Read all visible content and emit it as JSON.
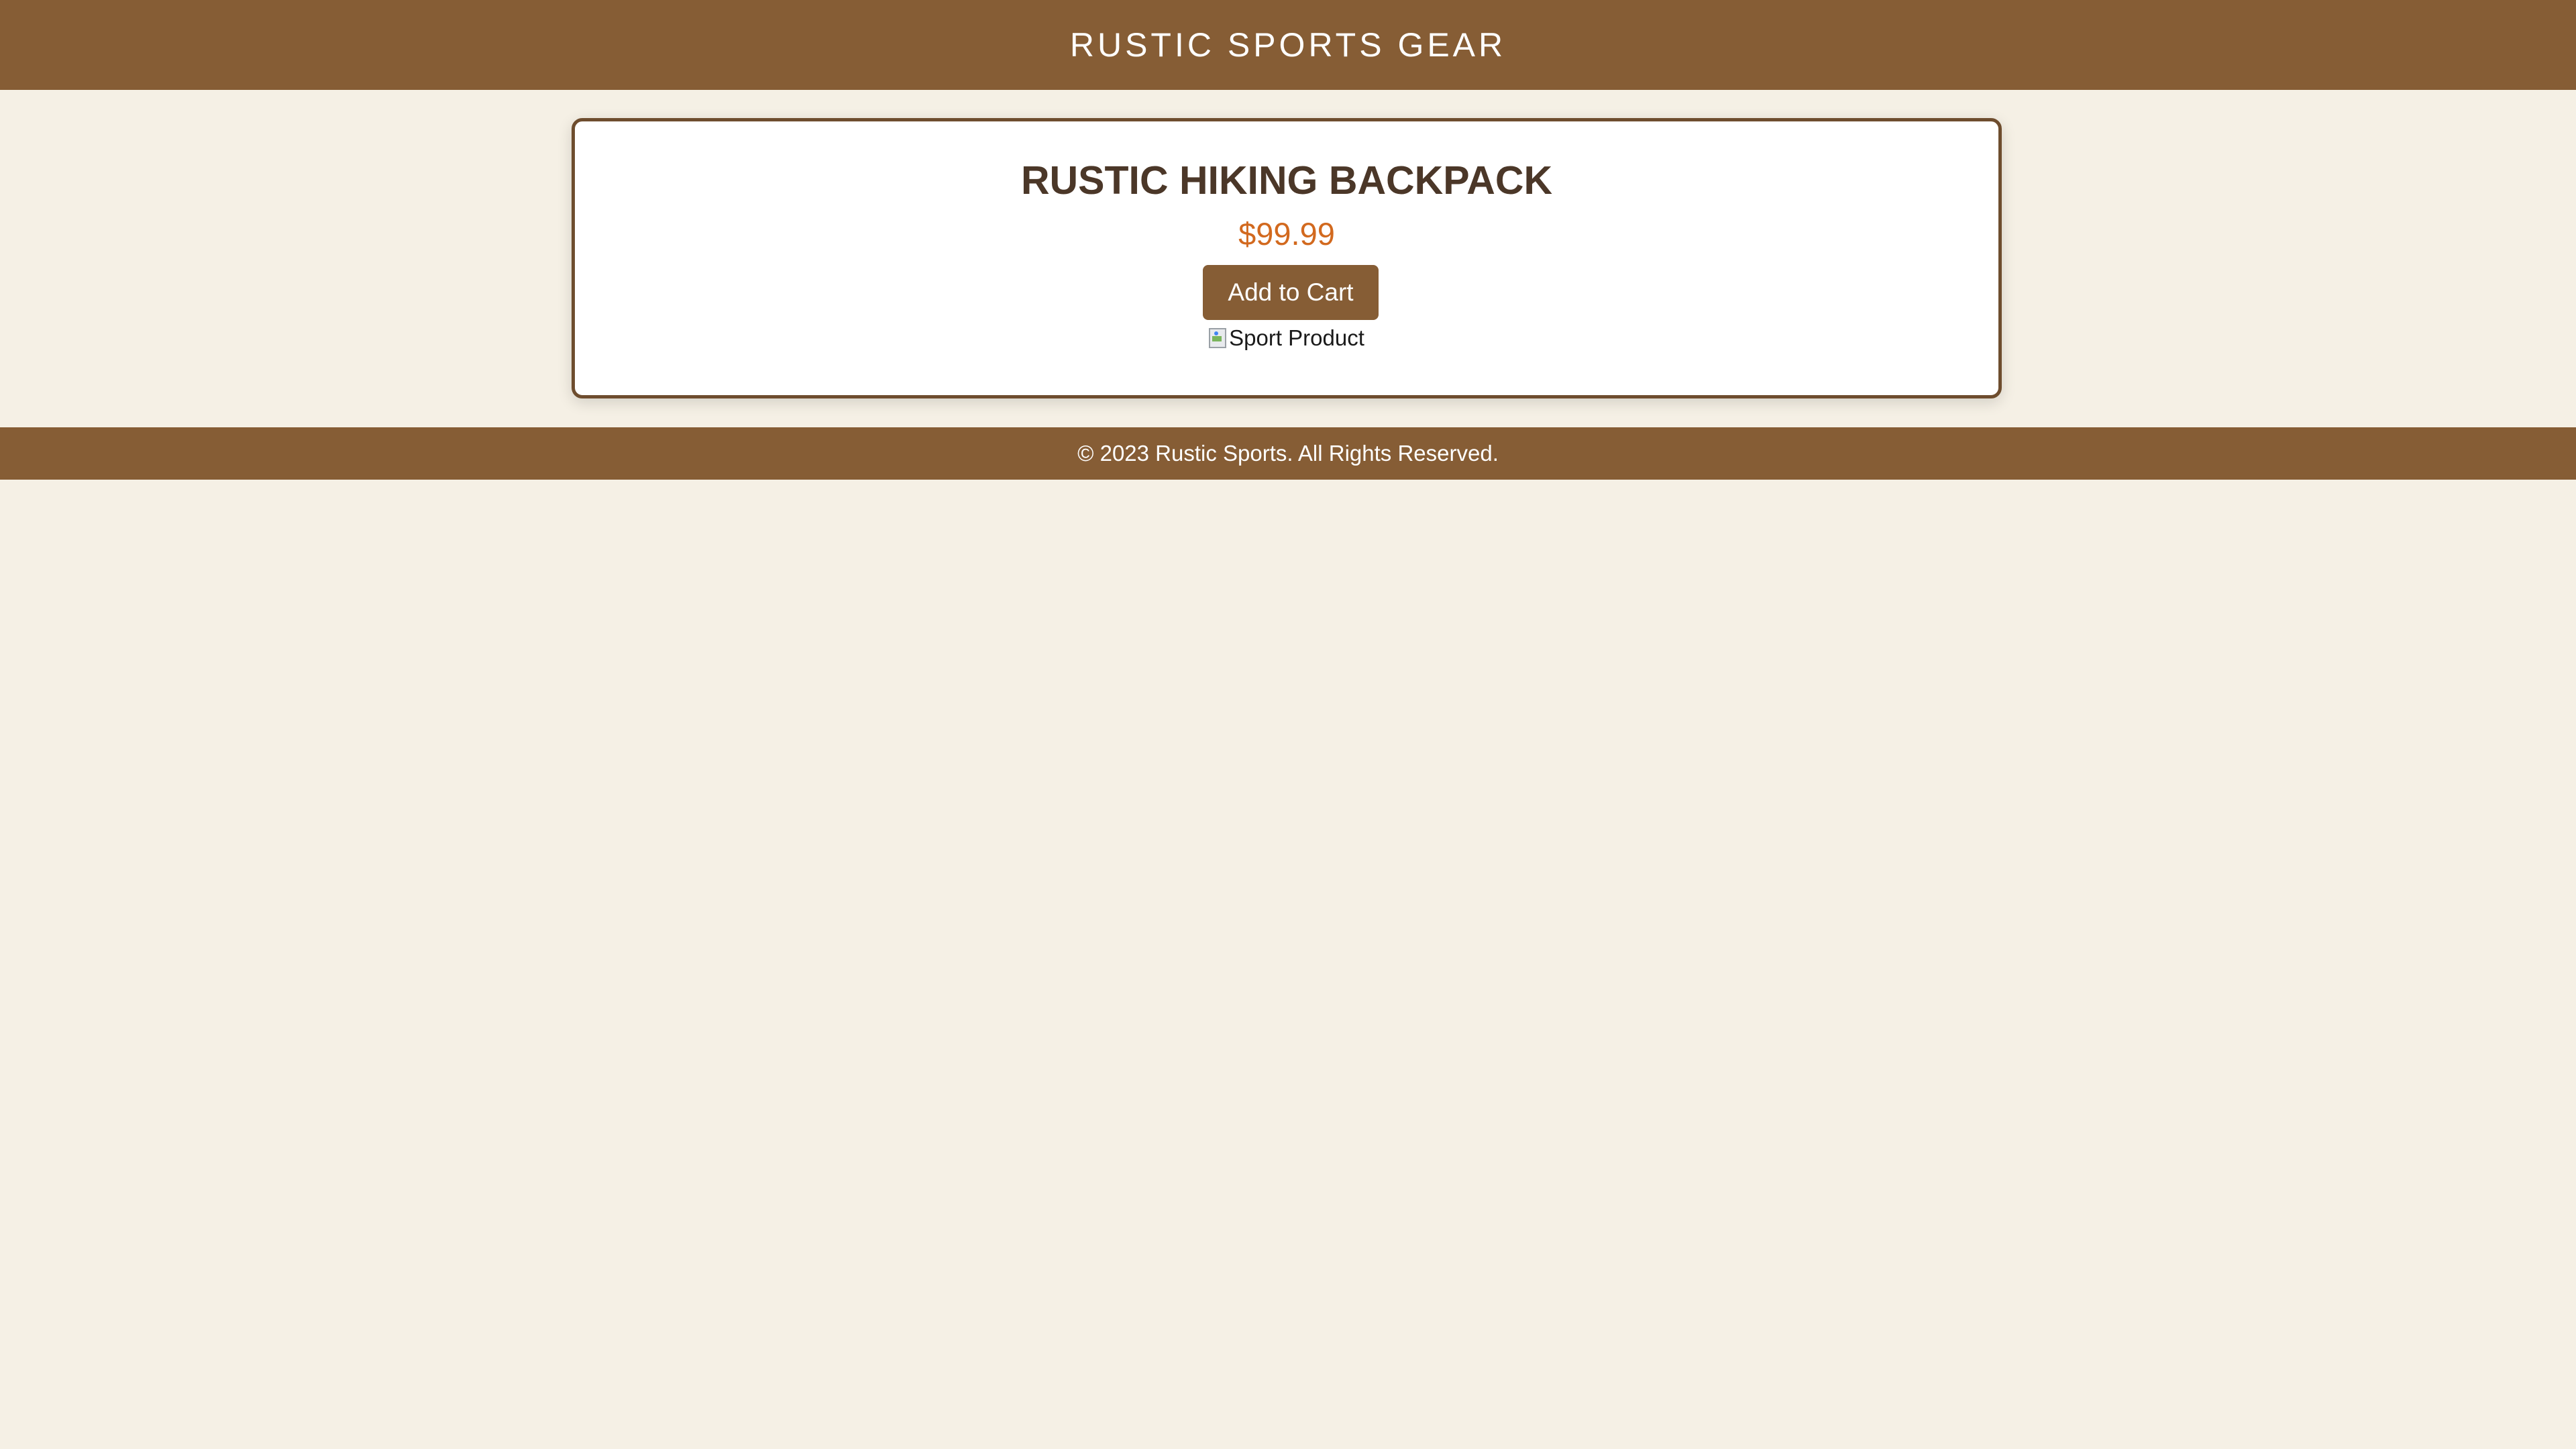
{
  "header": {
    "title": "RUSTIC SPORTS GEAR"
  },
  "product": {
    "name": "RUSTIC HIKING BACKPACK",
    "price": "$99.99",
    "add_to_cart_label": "Add to Cart",
    "image_alt": "Sport Product",
    "image_icon": "broken-image-icon"
  },
  "footer": {
    "copyright": "© 2023 Rustic Sports. All Rights Reserved."
  },
  "colors": {
    "brand_brown": "#865d35",
    "background": "#f5f0e5",
    "price_accent": "#d2691e",
    "heading_text": "#4b3728"
  }
}
